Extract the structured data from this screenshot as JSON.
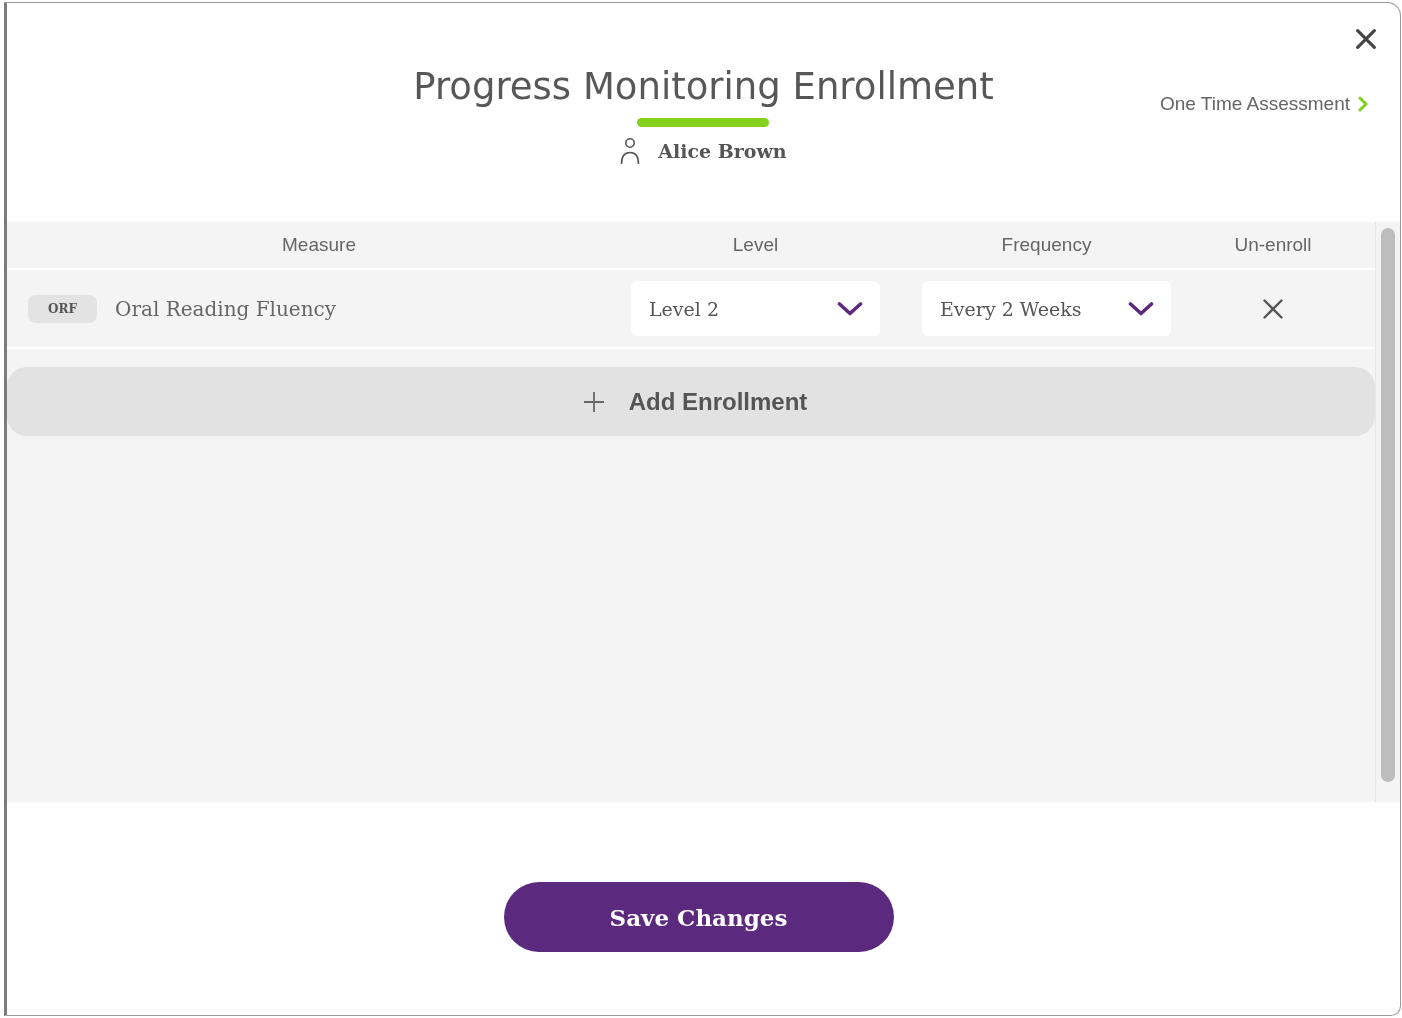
{
  "dialog": {
    "title": "Progress Monitoring Enrollment",
    "student": "Alice Brown",
    "one_time_link": "One Time Assessment"
  },
  "table": {
    "columns": [
      "Measure",
      "Level",
      "Frequency",
      "Un-enroll"
    ],
    "rows": [
      {
        "code": "ORF",
        "measure": "Oral Reading Fluency",
        "level": "Level 2",
        "frequency": "Every 2 Weeks"
      }
    ]
  },
  "add_button": "Add Enrollment",
  "save_button": "Save Changes"
}
